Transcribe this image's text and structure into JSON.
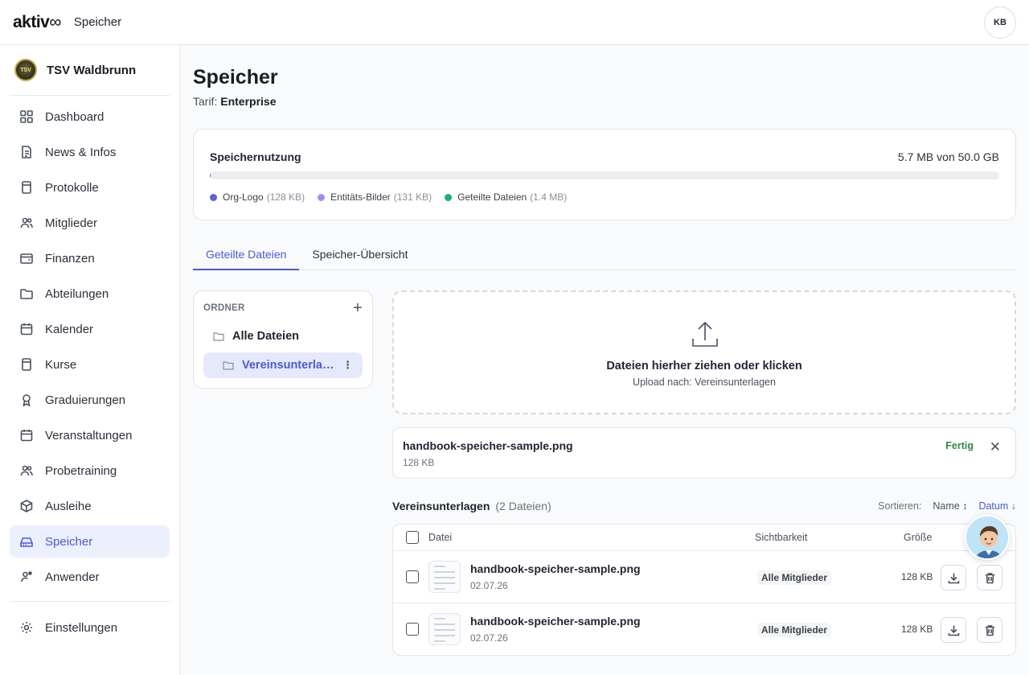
{
  "topbar": {
    "brand": "aktiv",
    "brand_suffix": "∞",
    "title": "Speicher",
    "user_initials": "KB"
  },
  "sidebar": {
    "org_name": "TSV Waldbrunn",
    "org_logo_text": "TSV",
    "items": [
      {
        "label": "Dashboard",
        "icon": "grid-icon"
      },
      {
        "label": "News & Infos",
        "icon": "document-icon"
      },
      {
        "label": "Protokolle",
        "icon": "book-icon"
      },
      {
        "label": "Mitglieder",
        "icon": "users-icon"
      },
      {
        "label": "Finanzen",
        "icon": "wallet-icon"
      },
      {
        "label": "Abteilungen",
        "icon": "folder-icon"
      },
      {
        "label": "Kalender",
        "icon": "calendar-icon"
      },
      {
        "label": "Kurse",
        "icon": "book-icon"
      },
      {
        "label": "Graduierungen",
        "icon": "award-icon"
      },
      {
        "label": "Veranstaltungen",
        "icon": "calendar-icon"
      },
      {
        "label": "Probetraining",
        "icon": "users-icon"
      },
      {
        "label": "Ausleihe",
        "icon": "box-icon"
      },
      {
        "label": "Speicher",
        "icon": "hard-drive-icon",
        "active": true
      },
      {
        "label": "Anwender",
        "icon": "user-cog-icon"
      }
    ],
    "settings_label": "Einstellungen"
  },
  "page": {
    "title": "Speicher",
    "plan_label": "Tarif:",
    "plan_value": "Enterprise"
  },
  "usage": {
    "title": "Speichernutzung",
    "amount": "5.7 MB von 50.0 GB",
    "used_fraction": 0.000114,
    "legend": [
      {
        "label": "Org-Logo",
        "size": "(128 KB)",
        "color": "#5b63e0"
      },
      {
        "label": "Entitäts-Bilder",
        "size": "(131 KB)",
        "color": "#a98bf0"
      },
      {
        "label": "Geteilte Dateien",
        "size": "(1.4 MB)",
        "color": "#1fae7a"
      }
    ]
  },
  "tabs": [
    {
      "label": "Geteilte Dateien",
      "active": true
    },
    {
      "label": "Speicher-Übersicht",
      "active": false
    }
  ],
  "folders": {
    "header": "ORDNER",
    "add_label": "+",
    "items": [
      {
        "label": "Alle Dateien",
        "selected": false
      },
      {
        "label": "Vereinsunterlagen",
        "selected": true
      }
    ],
    "kebab": "⋮"
  },
  "dropzone": {
    "title": "Dateien hierher ziehen oder klicken",
    "subtitle": "Upload nach: Vereinsunterlagen"
  },
  "upload": {
    "filename": "handbook-speicher-sample.png",
    "size": "128 KB",
    "status": "Fertig",
    "status_color": "#2c8a44",
    "close": "✕"
  },
  "list": {
    "title": "Vereinsunterlagen",
    "count": "(2 Dateien)",
    "sort_label": "Sortieren:",
    "sort_name": "Name ↕",
    "sort_date": "Datum ↓"
  },
  "table": {
    "headers": {
      "file": "Datei",
      "visibility": "Sichtbarkeit",
      "size": "Größe"
    },
    "rows": [
      {
        "name": "handbook-speicher-sample.png",
        "date": "02.07.26",
        "visibility": "Alle Mitglieder",
        "size": "128 KB"
      },
      {
        "name": "handbook-speicher-sample.png",
        "date": "02.07.26",
        "visibility": "Alle Mitglieder",
        "size": "128 KB"
      }
    ]
  },
  "colors": {
    "accent": "#4a5ad6",
    "active_bg": "#eceffc"
  }
}
